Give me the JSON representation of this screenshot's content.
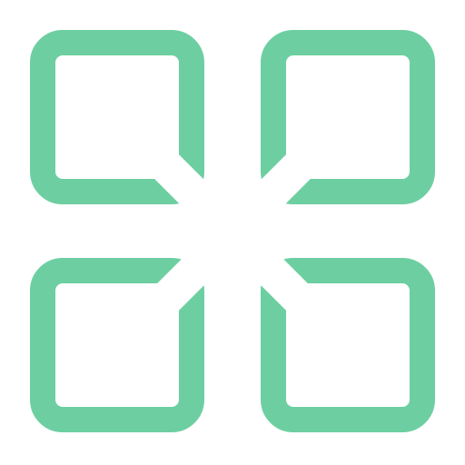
{
  "icon": {
    "name": "four-squares-grid-icon",
    "color": "#6DCFA1",
    "background": "#FFFFFF"
  }
}
